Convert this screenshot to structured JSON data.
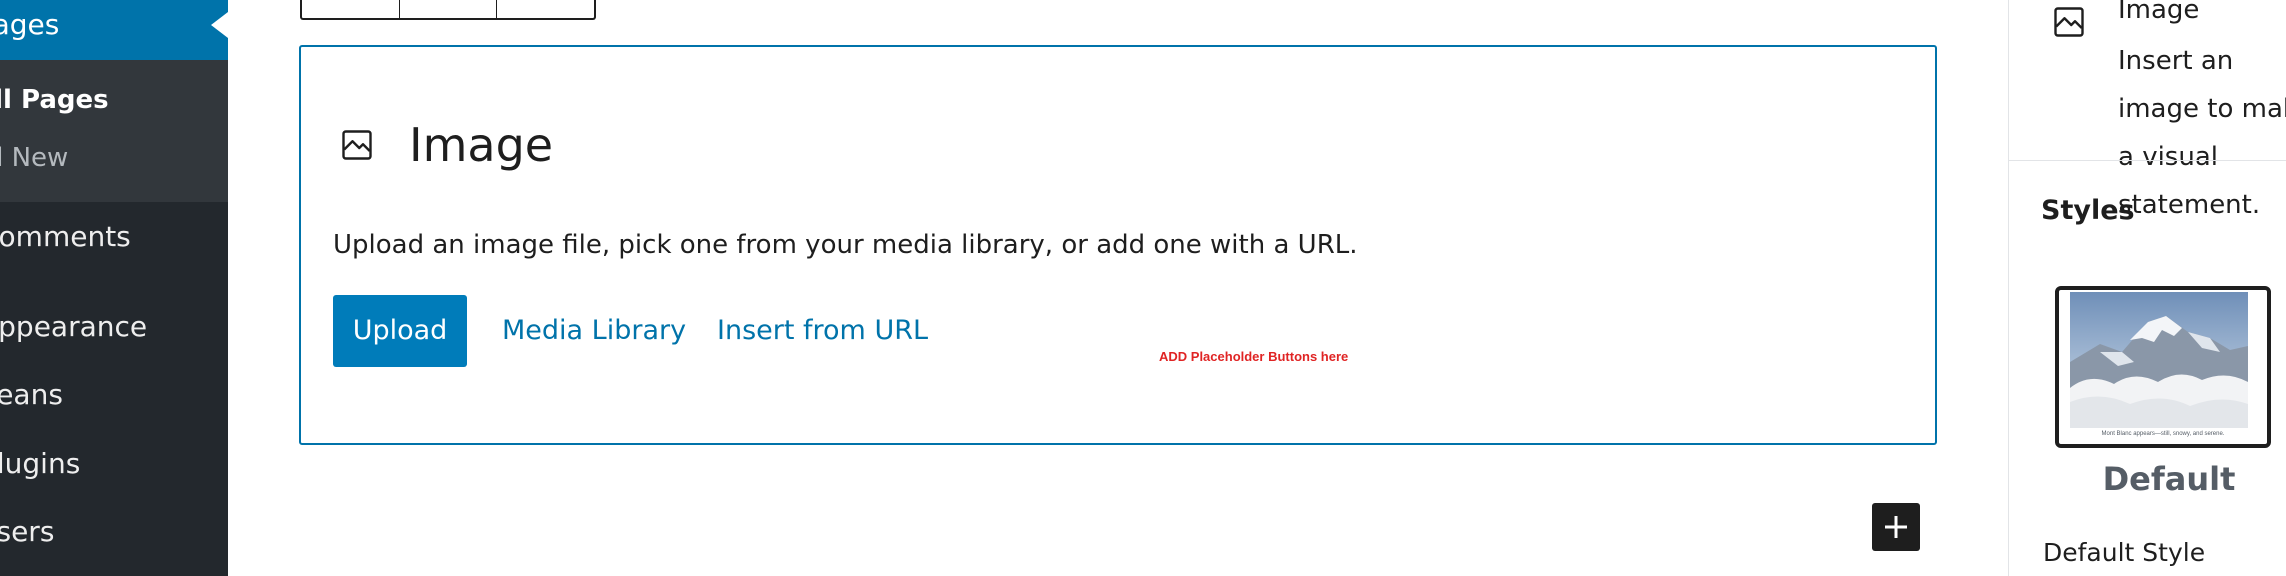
{
  "admin_menu": {
    "current": {
      "label": "Pages"
    },
    "submenu": [
      {
        "label": "All Pages",
        "active": true
      },
      {
        "label": "Add New",
        "active": false
      }
    ],
    "items": [
      {
        "label": "Comments"
      },
      {
        "label": "Appearance"
      },
      {
        "label": "Beans"
      },
      {
        "label": "Plugins"
      },
      {
        "label": "Users"
      }
    ],
    "colors": {
      "background": "#23282d",
      "submenu": "#32373c",
      "current": "#0073aa"
    }
  },
  "image_block": {
    "icon": "image-icon",
    "title": "Image",
    "instructions": "Upload an image file, pick one from your media library, or add one with a URL.",
    "buttons": {
      "upload": "Upload",
      "media_library": "Media Library",
      "insert_url": "Insert from URL"
    },
    "placeholder_note": "ADD Placeholder Buttons here",
    "colors": {
      "accent": "#0073aa",
      "button": "#007cba",
      "note": "#e02424"
    }
  },
  "inserter": {
    "icon": "plus-icon"
  },
  "settings_sidebar": {
    "block_card": {
      "icon": "image-icon",
      "title": "Image",
      "description": "Insert an image to make a visual statement."
    },
    "styles": {
      "heading": "Styles",
      "preview_caption": "Mont Blanc appears—still, snowy, and serene.",
      "preview_name": "Default",
      "default_style_label": "Default Style"
    }
  }
}
